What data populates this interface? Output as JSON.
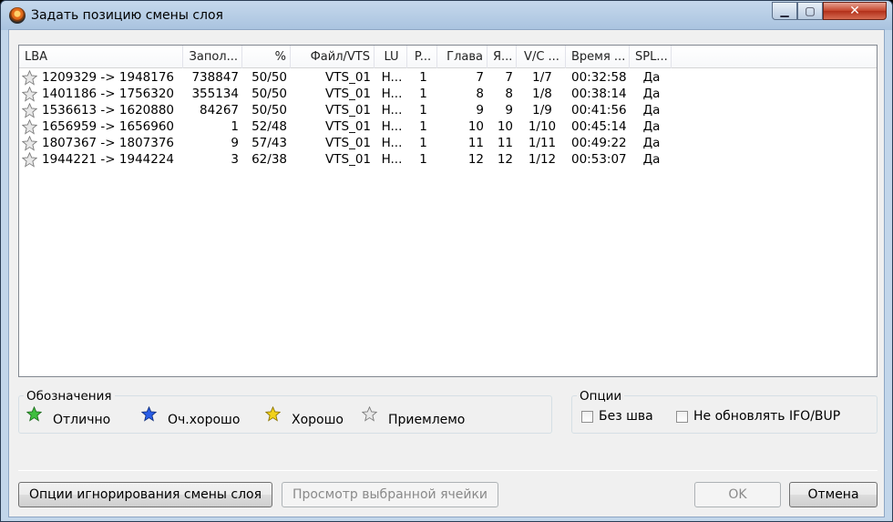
{
  "window": {
    "title": "Задать позицию смены слоя",
    "min_glyph": "▁",
    "max_glyph": "▢",
    "close_glyph": "✕"
  },
  "table": {
    "headers": [
      "LBA",
      "Запол...",
      "%",
      "Файл/VTS",
      "LU",
      "P...",
      "Глава",
      "Я...",
      "V/C ...",
      "Время ...",
      "SPL..."
    ],
    "rows": [
      {
        "star": "gray",
        "lba": "1209329 -> 1948176",
        "fill": "738847",
        "pct": "50/50",
        "file": "VTS_01",
        "lu": "H...",
        "p": "1",
        "chapter": "7",
        "cell": "7",
        "vc": "1/7",
        "time": "00:32:58",
        "spl": "Да"
      },
      {
        "star": "gray",
        "lba": "1401186 -> 1756320",
        "fill": "355134",
        "pct": "50/50",
        "file": "VTS_01",
        "lu": "H...",
        "p": "1",
        "chapter": "8",
        "cell": "8",
        "vc": "1/8",
        "time": "00:38:14",
        "spl": "Да"
      },
      {
        "star": "gray",
        "lba": "1536613 -> 1620880",
        "fill": "84267",
        "pct": "50/50",
        "file": "VTS_01",
        "lu": "H...",
        "p": "1",
        "chapter": "9",
        "cell": "9",
        "vc": "1/9",
        "time": "00:41:56",
        "spl": "Да"
      },
      {
        "star": "gray",
        "lba": "1656959 -> 1656960",
        "fill": "1",
        "pct": "52/48",
        "file": "VTS_01",
        "lu": "H...",
        "p": "1",
        "chapter": "10",
        "cell": "10",
        "vc": "1/10",
        "time": "00:45:14",
        "spl": "Да"
      },
      {
        "star": "gray",
        "lba": "1807367 -> 1807376",
        "fill": "9",
        "pct": "57/43",
        "file": "VTS_01",
        "lu": "H...",
        "p": "1",
        "chapter": "11",
        "cell": "11",
        "vc": "1/11",
        "time": "00:49:22",
        "spl": "Да"
      },
      {
        "star": "gray",
        "lba": "1944221 -> 1944224",
        "fill": "3",
        "pct": "62/38",
        "file": "VTS_01",
        "lu": "H...",
        "p": "1",
        "chapter": "12",
        "cell": "12",
        "vc": "1/12",
        "time": "00:53:07",
        "spl": "Да"
      }
    ]
  },
  "legend": {
    "title": "Обозначения",
    "items": [
      {
        "label": "Отлично",
        "color": "#3fbf3f"
      },
      {
        "label": "Оч.хорошо",
        "color": "#2a5ee8"
      },
      {
        "label": "Хорошо",
        "color": "#f2d21a"
      },
      {
        "label": "Приемлемо",
        "color": "#c8c8c8"
      }
    ]
  },
  "options": {
    "title": "Опции",
    "seamless": {
      "label": "Без шва",
      "checked": false
    },
    "no_update": {
      "label": "Не обновлять IFO/BUP",
      "checked": false
    }
  },
  "buttons": {
    "ignore_options": "Опции игнорирования смены слоя",
    "view_cell": "Просмотр выбранной ячейки",
    "ok": "OK",
    "cancel": "Отмена"
  },
  "colors": {
    "star_gray": "#c8c8c8",
    "accent_close": "#c4442a"
  }
}
